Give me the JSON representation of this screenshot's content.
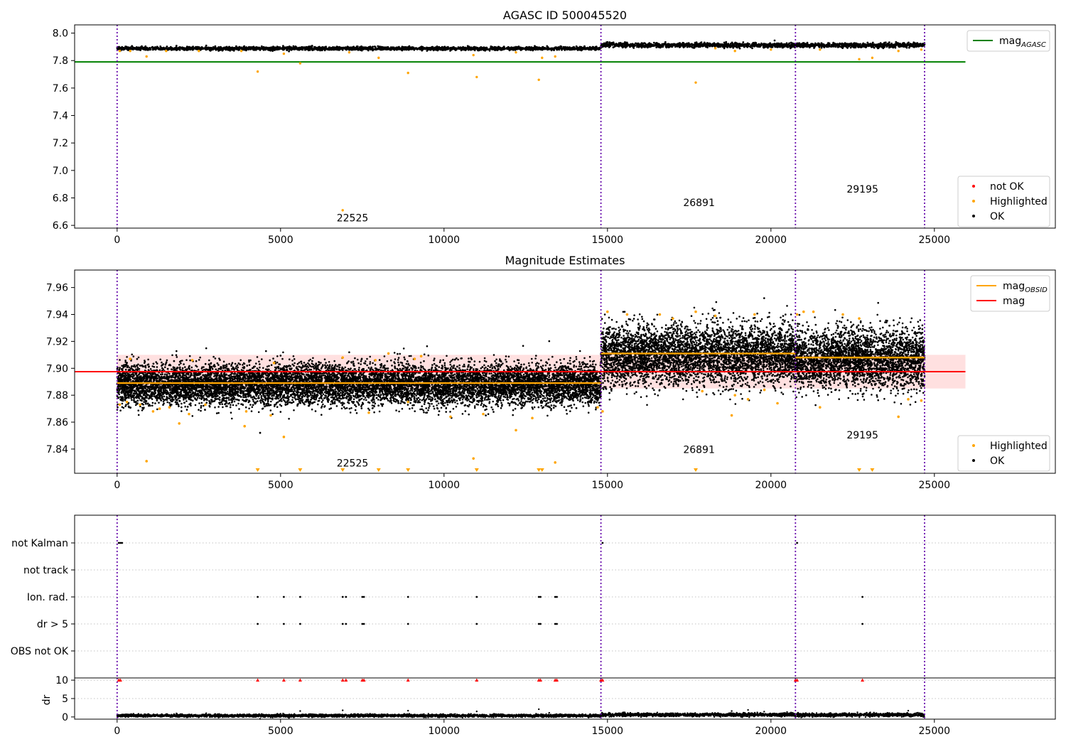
{
  "figure": {
    "background": "#ffffff"
  },
  "colors": {
    "ok": "#000000",
    "highlighted": "#ffa500",
    "not_ok": "#ff0000",
    "agasc_line": "#008000",
    "mag_line": "#ff0000",
    "obs_line": "#ffa500",
    "band": "#ffcccc",
    "obsid_vline": "#6a0dad"
  },
  "chart_data": [
    {
      "id": "agasc",
      "type": "scatter",
      "title": "AGASC ID 500045520",
      "xlim": [
        -1300,
        28700
      ],
      "ylim": [
        6.58,
        8.06
      ],
      "x_ticks": [
        0,
        5000,
        10000,
        15000,
        20000,
        25000
      ],
      "x_tick_labels": [
        "0",
        "5000",
        "10000",
        "15000",
        "20000",
        "25000"
      ],
      "y_ticks": [
        6.6,
        6.8,
        7.0,
        7.2,
        7.4,
        7.6,
        7.8,
        8.0
      ],
      "y_tick_labels": [
        "6.6",
        "6.8",
        "7.0",
        "7.2",
        "7.4",
        "7.6",
        "7.8",
        "8.0"
      ],
      "vlines": [
        0,
        14800,
        20750,
        24700
      ],
      "hline": {
        "y": 7.79,
        "x": [
          -1300,
          25950
        ],
        "color": "#008000"
      },
      "segments": [
        {
          "x": [
            0,
            14800
          ],
          "mean": 7.888,
          "spread": 0.006
        },
        {
          "x": [
            14800,
            20750
          ],
          "mean": 7.912,
          "spread": 0.008
        },
        {
          "x": [
            20750,
            24700
          ],
          "mean": 7.912,
          "spread": 0.008
        }
      ],
      "highlighted_points": [
        [
          80,
          7.87
        ],
        [
          400,
          7.87
        ],
        [
          900,
          7.83
        ],
        [
          1500,
          7.87
        ],
        [
          2500,
          7.87
        ],
        [
          3800,
          7.87
        ],
        [
          4300,
          7.72
        ],
        [
          5100,
          7.85
        ],
        [
          5600,
          7.78
        ],
        [
          6900,
          6.71
        ],
        [
          7100,
          7.86
        ],
        [
          8000,
          7.82
        ],
        [
          8900,
          7.71
        ],
        [
          10900,
          7.84
        ],
        [
          11000,
          7.68
        ],
        [
          12200,
          7.86
        ],
        [
          12900,
          7.66
        ],
        [
          13000,
          7.82
        ],
        [
          13400,
          7.83
        ],
        [
          17700,
          7.64
        ],
        [
          18300,
          7.89
        ],
        [
          18900,
          7.87
        ],
        [
          20000,
          7.88
        ],
        [
          21500,
          7.88
        ],
        [
          22700,
          7.81
        ],
        [
          23100,
          7.82
        ],
        [
          23900,
          7.87
        ],
        [
          24600,
          7.88
        ]
      ],
      "annotations": [
        {
          "x": 7200,
          "y": 6.63,
          "text": "22525"
        },
        {
          "x": 17800,
          "y": 6.74,
          "text": "26891"
        },
        {
          "x": 22800,
          "y": 6.84,
          "text": "29195"
        }
      ],
      "legend_top": [
        {
          "label": "mag",
          "sub": "AGASC",
          "kind": "line",
          "color": "#008000"
        }
      ],
      "legend_bottom": [
        {
          "label": "not OK",
          "kind": "dot",
          "color": "#ff0000"
        },
        {
          "label": "Highlighted",
          "kind": "dot",
          "color": "#ffa500"
        },
        {
          "label": "OK",
          "kind": "dot",
          "color": "#000000"
        }
      ]
    },
    {
      "id": "estimates",
      "type": "scatter",
      "title": "Magnitude Estimates",
      "xlim": [
        -1300,
        28700
      ],
      "ylim": [
        7.822,
        7.973
      ],
      "x_ticks": [
        0,
        5000,
        10000,
        15000,
        20000,
        25000
      ],
      "x_tick_labels": [
        "0",
        "5000",
        "10000",
        "15000",
        "20000",
        "25000"
      ],
      "y_ticks": [
        7.84,
        7.86,
        7.88,
        7.9,
        7.92,
        7.94,
        7.96
      ],
      "y_tick_labels": [
        "7.84",
        "7.86",
        "7.88",
        "7.90",
        "7.92",
        "7.94",
        "7.96"
      ],
      "vlines": [
        0,
        14800,
        20750,
        24700
      ],
      "mag_line": {
        "y": 7.8975,
        "x": [
          -1300,
          25950
        ],
        "color": "#ff0000"
      },
      "band": {
        "y": [
          7.885,
          7.91
        ],
        "x": [
          0,
          25950
        ],
        "color": "#ffcccc"
      },
      "obs_lines": [
        {
          "x": [
            0,
            14800
          ],
          "y": 7.889
        },
        {
          "x": [
            14800,
            20750
          ],
          "y": 7.911
        },
        {
          "x": [
            20750,
            24700
          ],
          "y": 7.908
        }
      ],
      "segments": [
        {
          "x": [
            0,
            14800
          ],
          "mean": 7.888,
          "spread": 0.0075
        },
        {
          "x": [
            14800,
            20750
          ],
          "mean": 7.91,
          "spread": 0.011
        },
        {
          "x": [
            20750,
            24700
          ],
          "mean": 7.907,
          "spread": 0.011
        }
      ],
      "highlighted_points": [
        [
          80,
          7.873
        ],
        [
          300,
          7.875
        ],
        [
          400,
          7.907
        ],
        [
          700,
          7.873
        ],
        [
          900,
          7.831
        ],
        [
          1100,
          7.868
        ],
        [
          1300,
          7.87
        ],
        [
          1600,
          7.871
        ],
        [
          1900,
          7.859
        ],
        [
          2200,
          7.866
        ],
        [
          2300,
          7.906
        ],
        [
          2700,
          7.873
        ],
        [
          3900,
          7.857
        ],
        [
          3950,
          7.868
        ],
        [
          4700,
          7.865
        ],
        [
          4800,
          7.904
        ],
        [
          5100,
          7.849
        ],
        [
          6900,
          7.908
        ],
        [
          7700,
          7.867
        ],
        [
          7900,
          7.906
        ],
        [
          8300,
          7.911
        ],
        [
          8900,
          7.875
        ],
        [
          9100,
          7.907
        ],
        [
          9300,
          7.909
        ],
        [
          10200,
          7.864
        ],
        [
          10900,
          7.833
        ],
        [
          11200,
          7.866
        ],
        [
          12200,
          7.854
        ],
        [
          12700,
          7.863
        ],
        [
          13400,
          7.83
        ],
        [
          14700,
          7.871
        ],
        [
          14850,
          7.868
        ],
        [
          15000,
          7.942
        ],
        [
          15600,
          7.94
        ],
        [
          16600,
          7.94
        ],
        [
          17000,
          7.937
        ],
        [
          17700,
          7.942
        ],
        [
          17900,
          7.883
        ],
        [
          18300,
          7.939
        ],
        [
          18800,
          7.865
        ],
        [
          18900,
          7.88
        ],
        [
          19300,
          7.877
        ],
        [
          19500,
          7.94
        ],
        [
          19800,
          7.884
        ],
        [
          20200,
          7.874
        ],
        [
          20800,
          7.94
        ],
        [
          21000,
          7.942
        ],
        [
          21300,
          7.942
        ],
        [
          21500,
          7.871
        ],
        [
          22200,
          7.94
        ],
        [
          22700,
          7.937
        ],
        [
          23900,
          7.864
        ],
        [
          24200,
          7.877
        ],
        [
          24600,
          7.876
        ]
      ],
      "clipped_low": [
        4300,
        5600,
        6900,
        8000,
        8900,
        11000,
        12900,
        13000,
        17700,
        22700,
        23100
      ],
      "annotations": [
        {
          "x": 7200,
          "y": 7.827,
          "text": "22525"
        },
        {
          "x": 17800,
          "y": 7.837,
          "text": "26891"
        },
        {
          "x": 22800,
          "y": 7.848,
          "text": "29195"
        }
      ],
      "legend_top": [
        {
          "label": "mag",
          "sub": "OBSID",
          "kind": "line",
          "color": "#ffa500"
        },
        {
          "label": "mag",
          "kind": "line",
          "color": "#ff0000"
        }
      ],
      "legend_bottom": [
        {
          "label": "Highlighted",
          "kind": "dot",
          "color": "#ffa500"
        },
        {
          "label": "OK",
          "kind": "dot",
          "color": "#000000"
        }
      ]
    },
    {
      "id": "flags",
      "type": "scatter",
      "xlim": [
        -1300,
        28700
      ],
      "categories": [
        "not Kalman",
        "not track",
        "Ion. rad.",
        "dr > 5",
        "OBS not OK"
      ],
      "vlines": [
        0,
        14800,
        20750,
        24700
      ],
      "flag_points": {
        "not Kalman": [
          50,
          100,
          150,
          14850,
          20800
        ],
        "not track": [],
        "Ion. rad.": [
          4300,
          5100,
          5600,
          6900,
          7000,
          7500,
          7550,
          8900,
          11000,
          12900,
          12950,
          13400,
          13450,
          22800
        ],
        "dr > 5": [
          4300,
          5100,
          5600,
          6900,
          7000,
          7500,
          7550,
          8900,
          11000,
          12900,
          12950,
          13400,
          13450,
          22800
        ],
        "OBS not OK": []
      }
    },
    {
      "id": "dr",
      "type": "scatter",
      "xlim": [
        -1300,
        28700
      ],
      "ylim": [
        -0.6,
        10.6
      ],
      "ylabel": "dr",
      "x_ticks": [
        0,
        5000,
        10000,
        15000,
        20000,
        25000
      ],
      "x_tick_labels": [
        "0",
        "5000",
        "10000",
        "15000",
        "20000",
        "25000"
      ],
      "y_ticks": [
        0,
        5,
        10
      ],
      "y_tick_labels": [
        "0",
        "5",
        "10"
      ],
      "vlines": [
        0,
        14800,
        20750,
        24700
      ],
      "segments": [
        {
          "x": [
            0,
            14800
          ],
          "mean": 0.35,
          "spread": 0.18
        },
        {
          "x": [
            14800,
            20750
          ],
          "mean": 0.6,
          "spread": 0.22
        },
        {
          "x": [
            20750,
            24700
          ],
          "mean": 0.55,
          "spread": 0.22
        }
      ],
      "clipped_high": [
        50,
        100,
        4300,
        5100,
        5600,
        6900,
        7000,
        7500,
        7550,
        8900,
        11000,
        12900,
        12950,
        13400,
        13450,
        14800,
        14850,
        20750,
        20800,
        22800
      ],
      "outliers": [
        [
          5600,
          1.6
        ],
        [
          6900,
          1.8
        ],
        [
          8900,
          1.7
        ],
        [
          11000,
          1.5
        ],
        [
          12900,
          2.1
        ],
        [
          18800,
          1.6
        ],
        [
          19300,
          1.9
        ],
        [
          24200,
          1.7
        ]
      ]
    }
  ]
}
